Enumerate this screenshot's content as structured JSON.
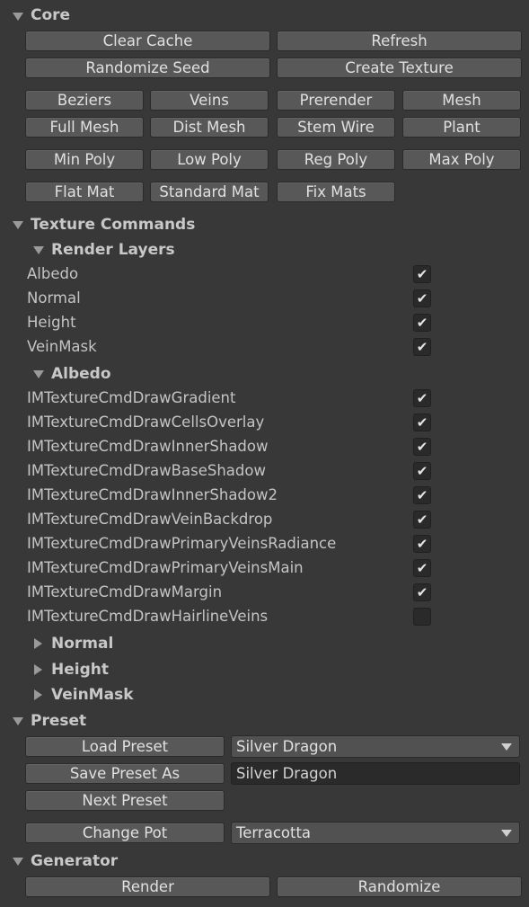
{
  "core": {
    "title": "Core",
    "row1": [
      "Clear Cache",
      "Refresh"
    ],
    "row2": [
      "Randomize Seed",
      "Create Texture"
    ],
    "row3": [
      "Beziers",
      "Veins",
      "Prerender",
      "Mesh"
    ],
    "row4": [
      "Full Mesh",
      "Dist Mesh",
      "Stem Wire",
      "Plant"
    ],
    "row5": [
      "Min Poly",
      "Low Poly",
      "Reg Poly",
      "Max Poly"
    ],
    "row6": [
      "Flat Mat",
      "Standard Mat",
      "Fix Mats"
    ]
  },
  "texture_commands": {
    "title": "Texture Commands",
    "render_layers": {
      "title": "Render Layers",
      "items": [
        {
          "label": "Albedo",
          "checked": true
        },
        {
          "label": "Normal",
          "checked": true
        },
        {
          "label": "Height",
          "checked": true
        },
        {
          "label": "VeinMask",
          "checked": true
        }
      ]
    },
    "albedo": {
      "title": "Albedo",
      "items": [
        {
          "label": "IMTextureCmdDrawGradient",
          "checked": true
        },
        {
          "label": "IMTextureCmdDrawCellsOverlay",
          "checked": true
        },
        {
          "label": "IMTextureCmdDrawInnerShadow",
          "checked": true
        },
        {
          "label": "IMTextureCmdDrawBaseShadow",
          "checked": true
        },
        {
          "label": "IMTextureCmdDrawInnerShadow2",
          "checked": true
        },
        {
          "label": "IMTextureCmdDrawVeinBackdrop",
          "checked": true
        },
        {
          "label": "IMTextureCmdDrawPrimaryVeinsRadiance",
          "checked": true
        },
        {
          "label": "IMTextureCmdDrawPrimaryVeinsMain",
          "checked": true
        },
        {
          "label": "IMTextureCmdDrawMargin",
          "checked": true
        },
        {
          "label": "IMTextureCmdDrawHairlineVeins",
          "checked": false
        }
      ]
    },
    "collapsed": [
      "Normal",
      "Height",
      "VeinMask"
    ]
  },
  "preset": {
    "title": "Preset",
    "load_label": "Load Preset",
    "load_value": "Silver Dragon",
    "save_label": "Save Preset As",
    "save_value": "Silver Dragon",
    "next_label": "Next Preset",
    "pot_label": "Change Pot",
    "pot_value": "Terracotta"
  },
  "generator": {
    "title": "Generator",
    "buttons": [
      "Render",
      "Randomize"
    ]
  },
  "check_glyph": "✔",
  "colors": {
    "background": "#383838",
    "button": "#585858",
    "field": "#2a2a2a"
  }
}
